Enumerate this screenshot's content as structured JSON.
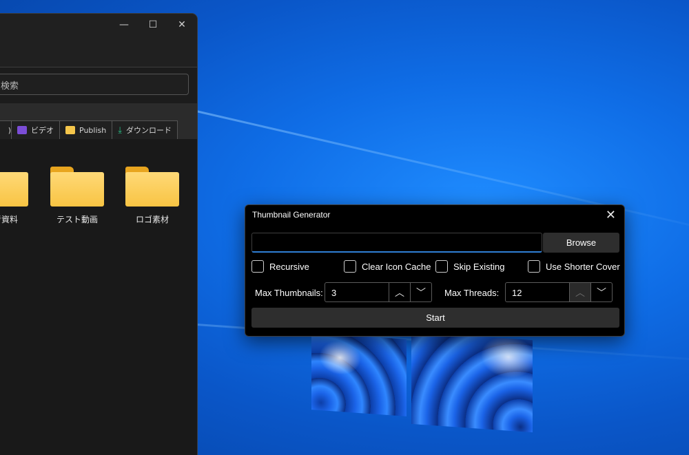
{
  "explorer": {
    "caption": {
      "minimize": "—",
      "maximize": "☐",
      "close": "✕"
    },
    "search_placeholder": "検索",
    "bookmarks": [
      {
        "label": ")",
        "icon": "folder-icon"
      },
      {
        "label": "ビデオ",
        "icon": "video-icon"
      },
      {
        "label": "Publish",
        "icon": "folder-icon"
      },
      {
        "label": "ダウンロード",
        "icon": "download-icon"
      }
    ],
    "folders": [
      {
        "label": "参考資料"
      },
      {
        "label": "テスト動画"
      },
      {
        "label": "ロゴ素材"
      }
    ]
  },
  "dialog": {
    "title": "Thumbnail Generator",
    "close_glyph": "✕",
    "path_value": "",
    "browse_label": "Browse",
    "options": [
      {
        "label": "Recursive",
        "checked": false
      },
      {
        "label": "Clear Icon Cache",
        "checked": false
      },
      {
        "label": "Skip Existing",
        "checked": false
      },
      {
        "label": "Use Shorter Cover",
        "checked": false
      }
    ],
    "max_thumbnails": {
      "label": "Max Thumbnails:",
      "value": "3"
    },
    "max_threads": {
      "label": "Max Threads:",
      "value": "12"
    },
    "spin_up_glyph": "︿",
    "spin_down_glyph": "﹀",
    "start_label": "Start"
  },
  "colors": {
    "accent": "#2f7fd6",
    "dialog_bg": "#000000",
    "button_bg": "#2e2e2e",
    "desktop": "#0f6de6"
  }
}
